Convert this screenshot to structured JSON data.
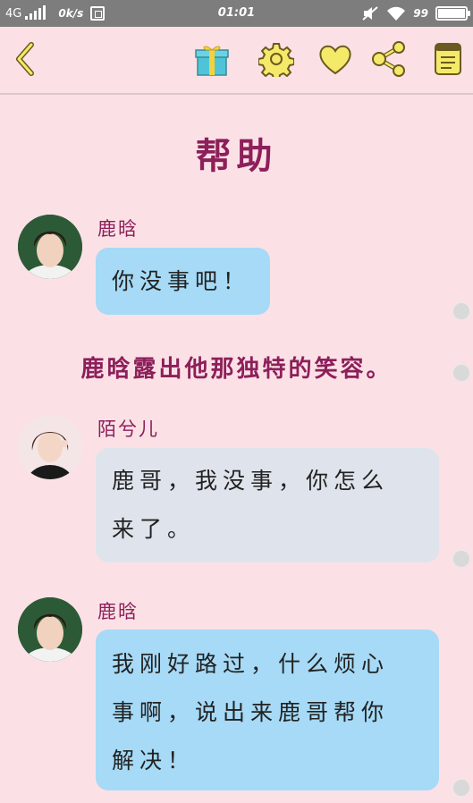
{
  "status_bar": {
    "network": "4G",
    "speed": "0k/s",
    "time": "01:01",
    "battery_text": "99",
    "battery_level": 0.99
  },
  "toolbar": {
    "icons": [
      "back-icon",
      "gift-icon",
      "gear-icon",
      "heart-icon",
      "share-icon",
      "book-icon"
    ],
    "accent": "#f5e96a",
    "icon_stroke": "#6b5a1e"
  },
  "page": {
    "title": "帮助"
  },
  "messages": [
    {
      "speaker": "鹿晗",
      "text": "你没事吧！",
      "style": "blue"
    },
    {
      "speaker": "陌兮儿",
      "text_lines": [
        "鹿哥，我没事，你怎么",
        "来了。"
      ],
      "style": "grey"
    },
    {
      "speaker": "鹿晗",
      "text_lines": [
        "我刚好路过，什么烦心",
        "事啊，说出来鹿哥帮你",
        "解决！"
      ],
      "style": "blue"
    }
  ],
  "narration": "鹿晗露出他那独特的笑容。",
  "colors": {
    "background": "#fbe1e6",
    "title": "#8d1f5a",
    "bubble_blue": "#a6daf6",
    "bubble_grey": "#dfe4ec"
  }
}
